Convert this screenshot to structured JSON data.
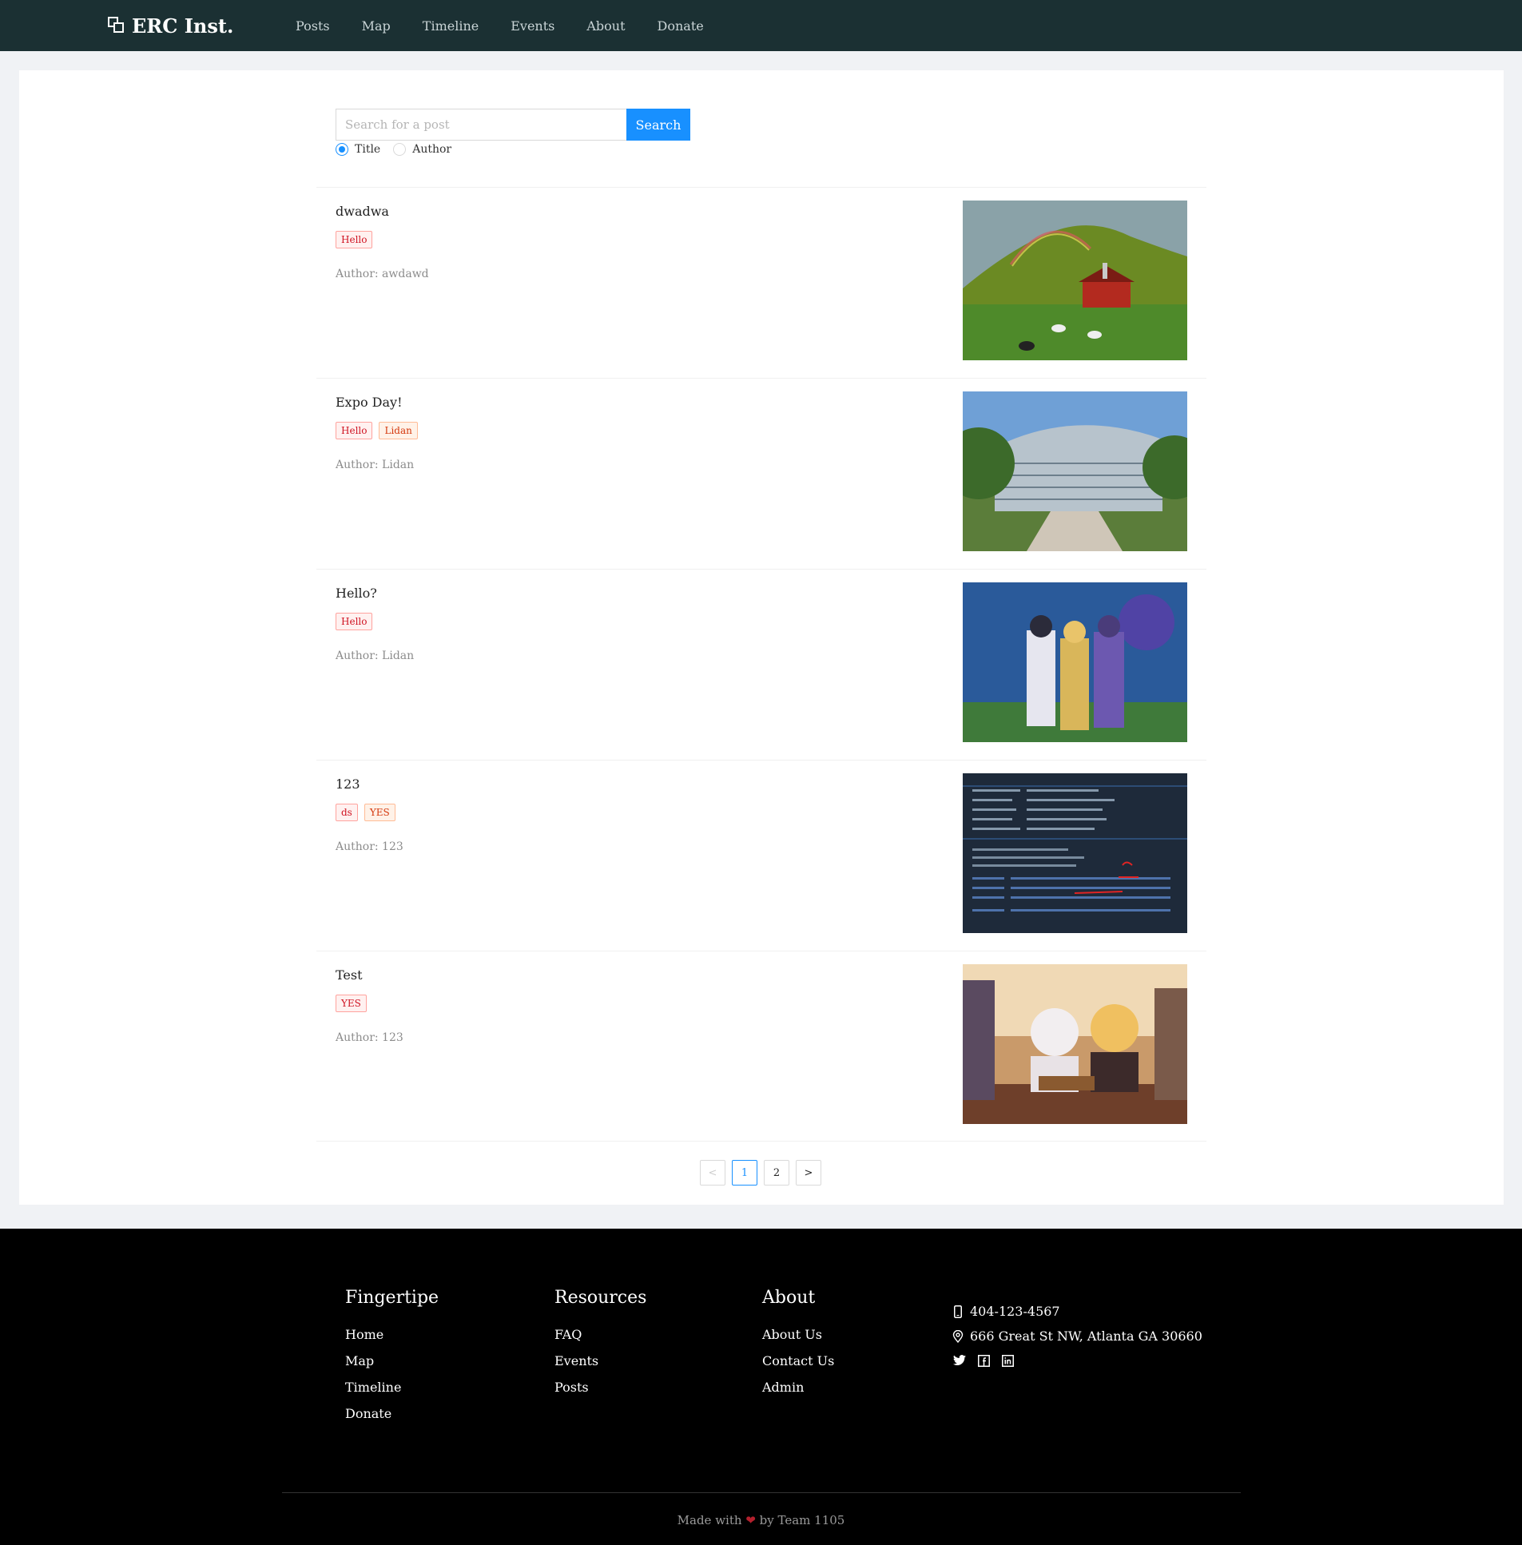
{
  "brand": {
    "name": "ERC Inst."
  },
  "nav": [
    "Posts",
    "Map",
    "Timeline",
    "Events",
    "About",
    "Donate"
  ],
  "search": {
    "placeholder": "Search for a post",
    "button_label": "Search",
    "options": [
      {
        "label": "Title",
        "checked": true
      },
      {
        "label": "Author",
        "checked": false
      }
    ]
  },
  "posts": [
    {
      "title": "dwadwa",
      "tags": [
        {
          "label": "Hello",
          "color": "red"
        }
      ],
      "author": "Author: awdawd"
    },
    {
      "title": "Expo Day!",
      "tags": [
        {
          "label": "Hello",
          "color": "red"
        },
        {
          "label": "Lidan",
          "color": "volcano"
        }
      ],
      "author": "Author: Lidan"
    },
    {
      "title": "Hello?",
      "tags": [
        {
          "label": "Hello",
          "color": "red"
        }
      ],
      "author": "Author: Lidan"
    },
    {
      "title": "123",
      "tags": [
        {
          "label": "ds",
          "color": "red"
        },
        {
          "label": "YES",
          "color": "volcano"
        }
      ],
      "author": "Author: 123"
    },
    {
      "title": "Test",
      "tags": [
        {
          "label": "YES",
          "color": "red"
        }
      ],
      "author": "Author: 123"
    }
  ],
  "pagination": {
    "prev": "<",
    "pages": [
      "1",
      "2"
    ],
    "current": "1",
    "next": ">"
  },
  "footer": {
    "columns": [
      {
        "title": "Fingertipe",
        "links": [
          "Home",
          "Map",
          "Timeline",
          "Donate"
        ]
      },
      {
        "title": "Resources",
        "links": [
          "FAQ",
          "Events",
          "Posts"
        ]
      },
      {
        "title": "About",
        "links": [
          "About Us",
          "Contact Us",
          "Admin"
        ]
      }
    ],
    "phone": "404-123-4567",
    "address": "666 Great St NW, Atlanta GA 30660",
    "social_icons": [
      "twitter-icon",
      "facebook-icon",
      "linkedin-icon"
    ],
    "made_with_prefix": "Made with",
    "made_with_suffix": "by Team 1105"
  },
  "colors": {
    "header_bg": "#1b3033",
    "accent": "#1890ff",
    "footer_bg": "#000000",
    "tag_red": "#cf1322",
    "tag_volcano": "#d4380d"
  }
}
